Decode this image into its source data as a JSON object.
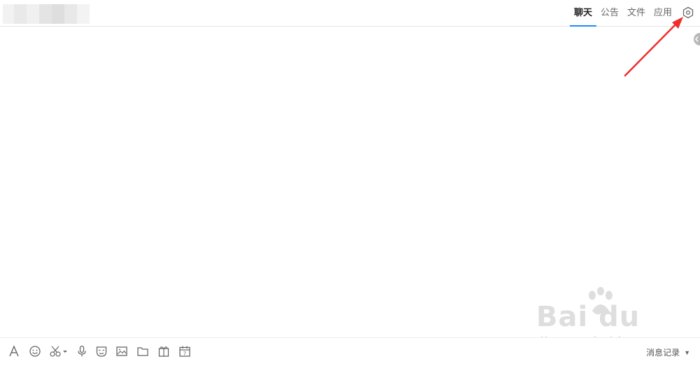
{
  "header": {
    "tabs": [
      {
        "label": "聊天",
        "active": true
      },
      {
        "label": "公告",
        "active": false
      },
      {
        "label": "文件",
        "active": false
      },
      {
        "label": "应用",
        "active": false
      }
    ],
    "settings_icon": "settings-hexagon-icon",
    "accent_color": "#1a8cff"
  },
  "annotation": {
    "color": "#ee2e2e",
    "icon": "red-arrow-icon"
  },
  "toolbar": {
    "tools": [
      "font-icon",
      "emoji-icon",
      "screenshot-scissors-icon",
      "voice-icon",
      "sticker-icon",
      "image-icon",
      "folder-icon",
      "gift-icon",
      "calendar-icon"
    ],
    "history_label": "消息记录"
  },
  "watermark": {
    "brand": "Bai du 经验",
    "url": "jingyan.baidu.com"
  }
}
